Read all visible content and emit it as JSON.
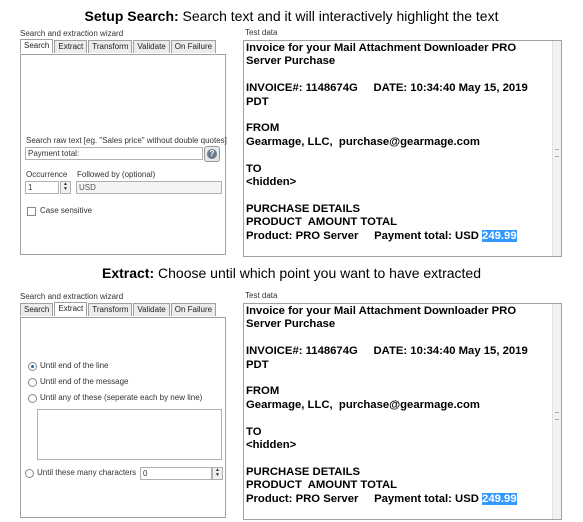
{
  "captions": {
    "search_bold": "Setup Search:",
    "search_rest": " Search text and it will interactively highlight the text",
    "extract_bold": "Extract:",
    "extract_rest": " Choose until which point you want to have extracted"
  },
  "wizard": {
    "title": "Search and extraction wizard",
    "tabs": [
      "Search",
      "Extract",
      "Transform",
      "Validate",
      "On Failure"
    ]
  },
  "search_tab": {
    "search_label": "Search raw text [eg. \"Sales price\" without double quotes]",
    "search_value": "Payment total:",
    "help_icon": "help-icon",
    "occurrence_label": "Occurrence",
    "occurrence_value": "1",
    "followed_by_label": "Followed by (optional)",
    "followed_by_value": "USD",
    "case_sensitive_label": "Case sensitive"
  },
  "extract_tab": {
    "option_end_of_line": "Until end of the line",
    "option_end_of_message": "Until end of the message",
    "option_any_of_these": "Until any of these (seperate each by new line)",
    "option_chars": "Until these many characters",
    "chars_value": "0",
    "selected": "Until end of the line"
  },
  "test_data": {
    "title": "Test data",
    "lines_before": "Invoice for your Mail Attachment Downloader PRO\nServer Purchase\n\nINVOICE#: 1148674G     DATE: 10:34:40 May 15, 2019\nPDT\n\nFROM\nGearmage, LLC,  purchase@gearmage.com\n\nTO\n<hidden>\n\nPURCHASE DETAILS\nPRODUCT  AMOUNT TOTAL\nProduct: PRO Server     Payment total: USD ",
    "highlight": "249.99"
  }
}
